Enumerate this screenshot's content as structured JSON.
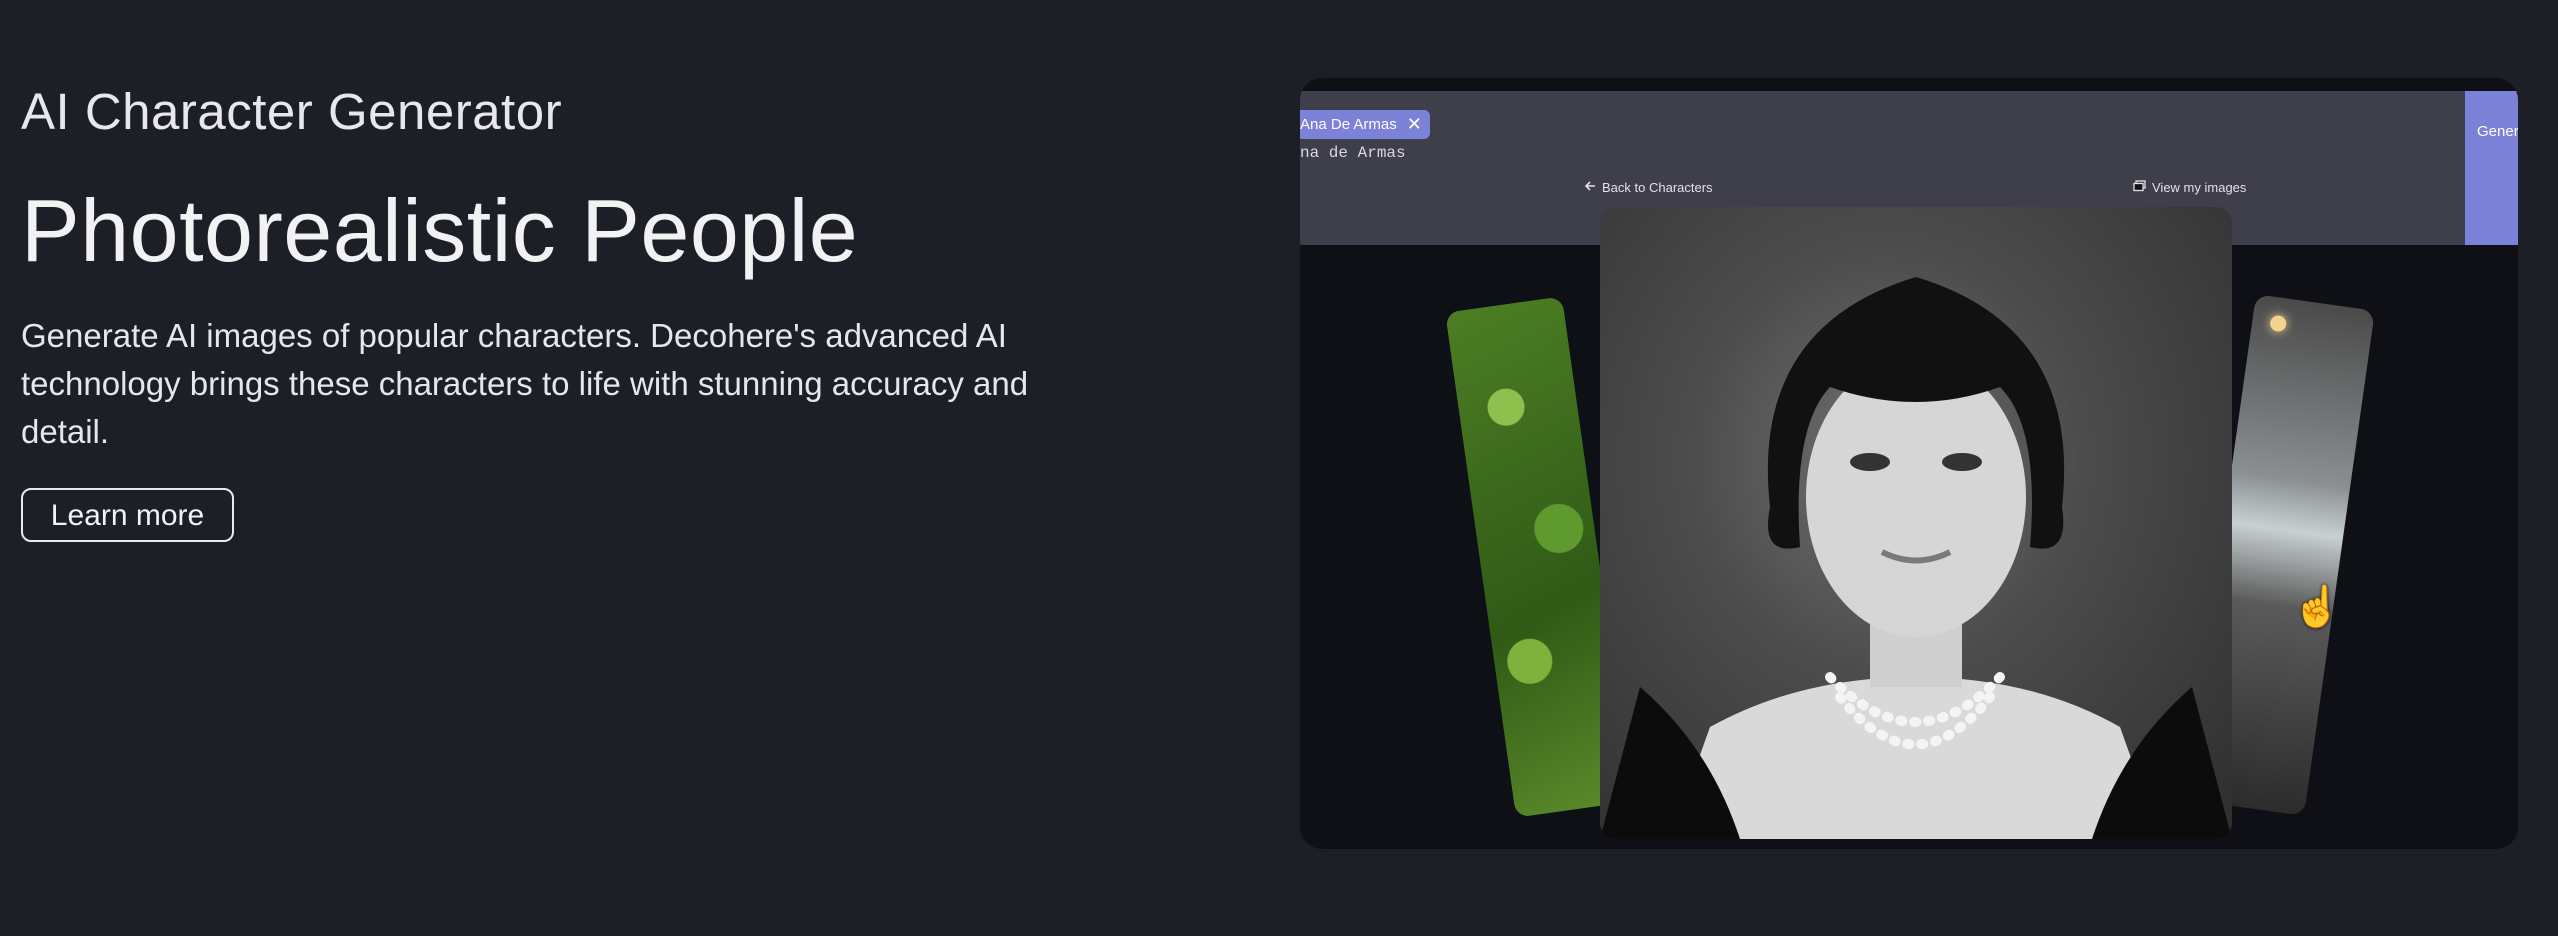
{
  "hero": {
    "eyebrow": "AI Character Generator",
    "headline": "Photorealistic People",
    "description": "Generate AI images of popular characters. Decohere's advanced AI technology brings these characters to life with stunning accuracy and detail.",
    "cta_label": "Learn more"
  },
  "preview": {
    "tag_label": "Ana De Armas",
    "tag_close_icon": "close-icon",
    "prompt_text": "na de Armas",
    "generate_label": "Gener",
    "back_label": "Back to Characters",
    "back_icon": "arrow-left-icon",
    "view_label": "View my images",
    "view_icon": "images-icon",
    "cursor_icon": "hand-pointer-icon"
  },
  "colors": {
    "background": "#1d1f27",
    "accent": "#7b82d8",
    "toolbar": "#3f3e4b"
  }
}
